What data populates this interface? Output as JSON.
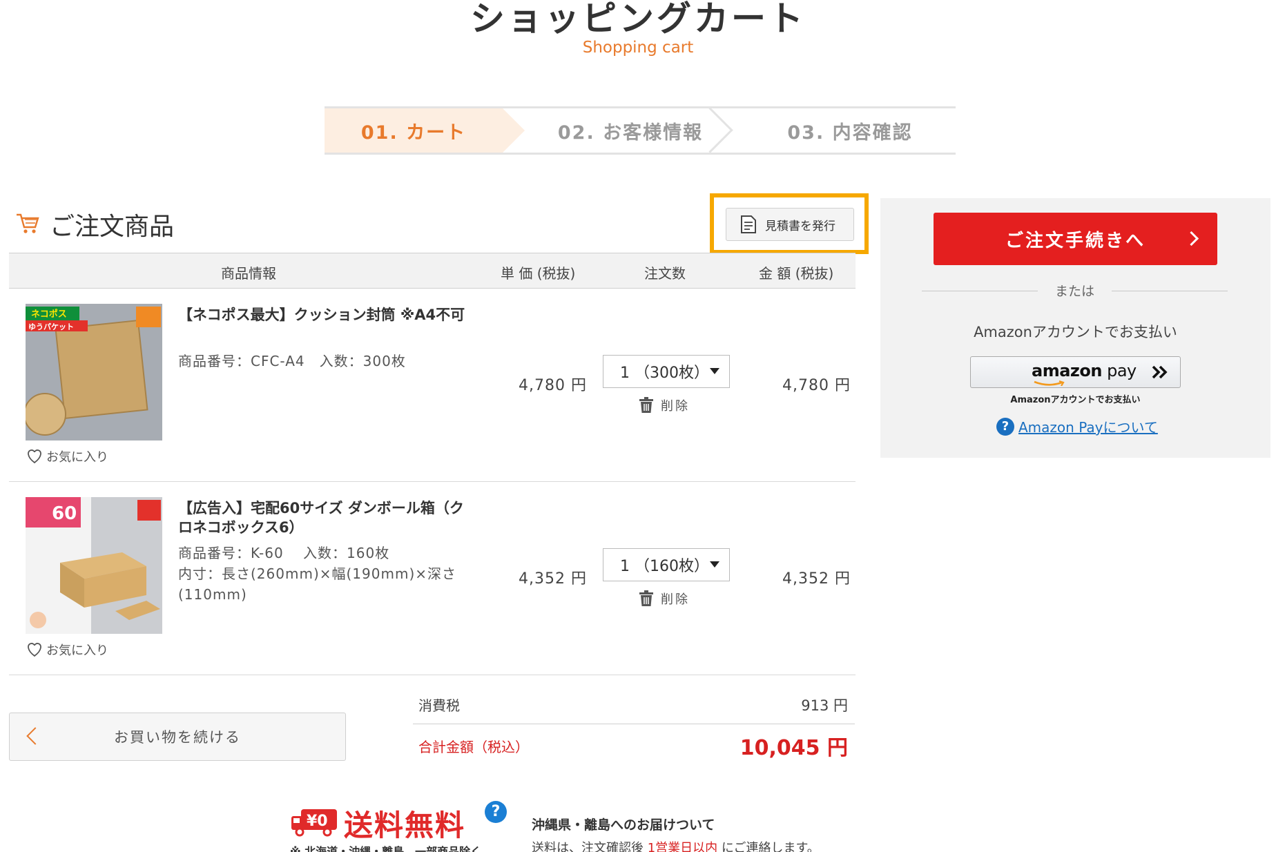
{
  "header": {
    "title": "ショッピングカート",
    "subtitle": "Shopping cart"
  },
  "steps": [
    {
      "label": "01. カート",
      "active": true
    },
    {
      "label": "02. お客様情報",
      "active": false
    },
    {
      "label": "03. 内容確認",
      "active": false
    }
  ],
  "section": {
    "title": "ご注文商品",
    "quote_button": "見積書を発行"
  },
  "table": {
    "headers": {
      "info": "商品情報",
      "price": "単 価 (税抜)",
      "qty": "注文数",
      "amount": "金 額 (税抜)"
    }
  },
  "items": [
    {
      "name": "【ネコポス最大】クッション封筒 ※A4不可",
      "meta": "商品番号：CFC-A4　入数：300枚",
      "unit_price": "4,780 円",
      "qty": "1 （300枚）",
      "delete_label": "削除",
      "amount": "4,780 円",
      "favorite_label": "お気に入り",
      "thumb_badge": "ネコポス",
      "thumb_badge2": "ゆうパケット"
    },
    {
      "name": "【広告入】宅配60サイズ ダンボール箱（クロネコボックス6）",
      "meta": "商品番号：K-60　 入数：160枚",
      "meta2": "内寸：長さ(260mm)×幅(190mm)×深さ(110mm)",
      "unit_price": "4,352 円",
      "qty": "1 （160枚）",
      "delete_label": "削除",
      "amount": "4,352 円",
      "favorite_label": "お気に入り",
      "thumb_badge": "60"
    }
  ],
  "summary": {
    "tax_label": "消費税",
    "tax_value": "913 円",
    "total_label": "合計金額（税込）",
    "total_value": "10,045 円"
  },
  "continue_button": "お買い物を続ける",
  "shipping": {
    "free_title": "送料無料",
    "free_badge": "¥0",
    "free_note": "※ 北海道・沖縄・離島、一部商品除く",
    "okinawa_title": "沖縄県・離島へのお届けついて",
    "okinawa_text_pre": "送料は、注文確認後 ",
    "okinawa_text_red": "1営業日以内",
    "okinawa_text_post": " にご連絡します。"
  },
  "side": {
    "order_button": "ご注文手続きへ",
    "or_text": "または",
    "amazon_caption": "Amazonアカウントでお支払い",
    "amazon_brand": "amazon",
    "amazon_pay": " pay",
    "amazon_sub": "Amazonアカウントでお支払い",
    "amazon_help": "Amazon Payについて"
  },
  "colors": {
    "accent": "#e87a2c",
    "red": "#e41f1f",
    "highlight": "#f6a800",
    "link": "#1a6fc0"
  }
}
